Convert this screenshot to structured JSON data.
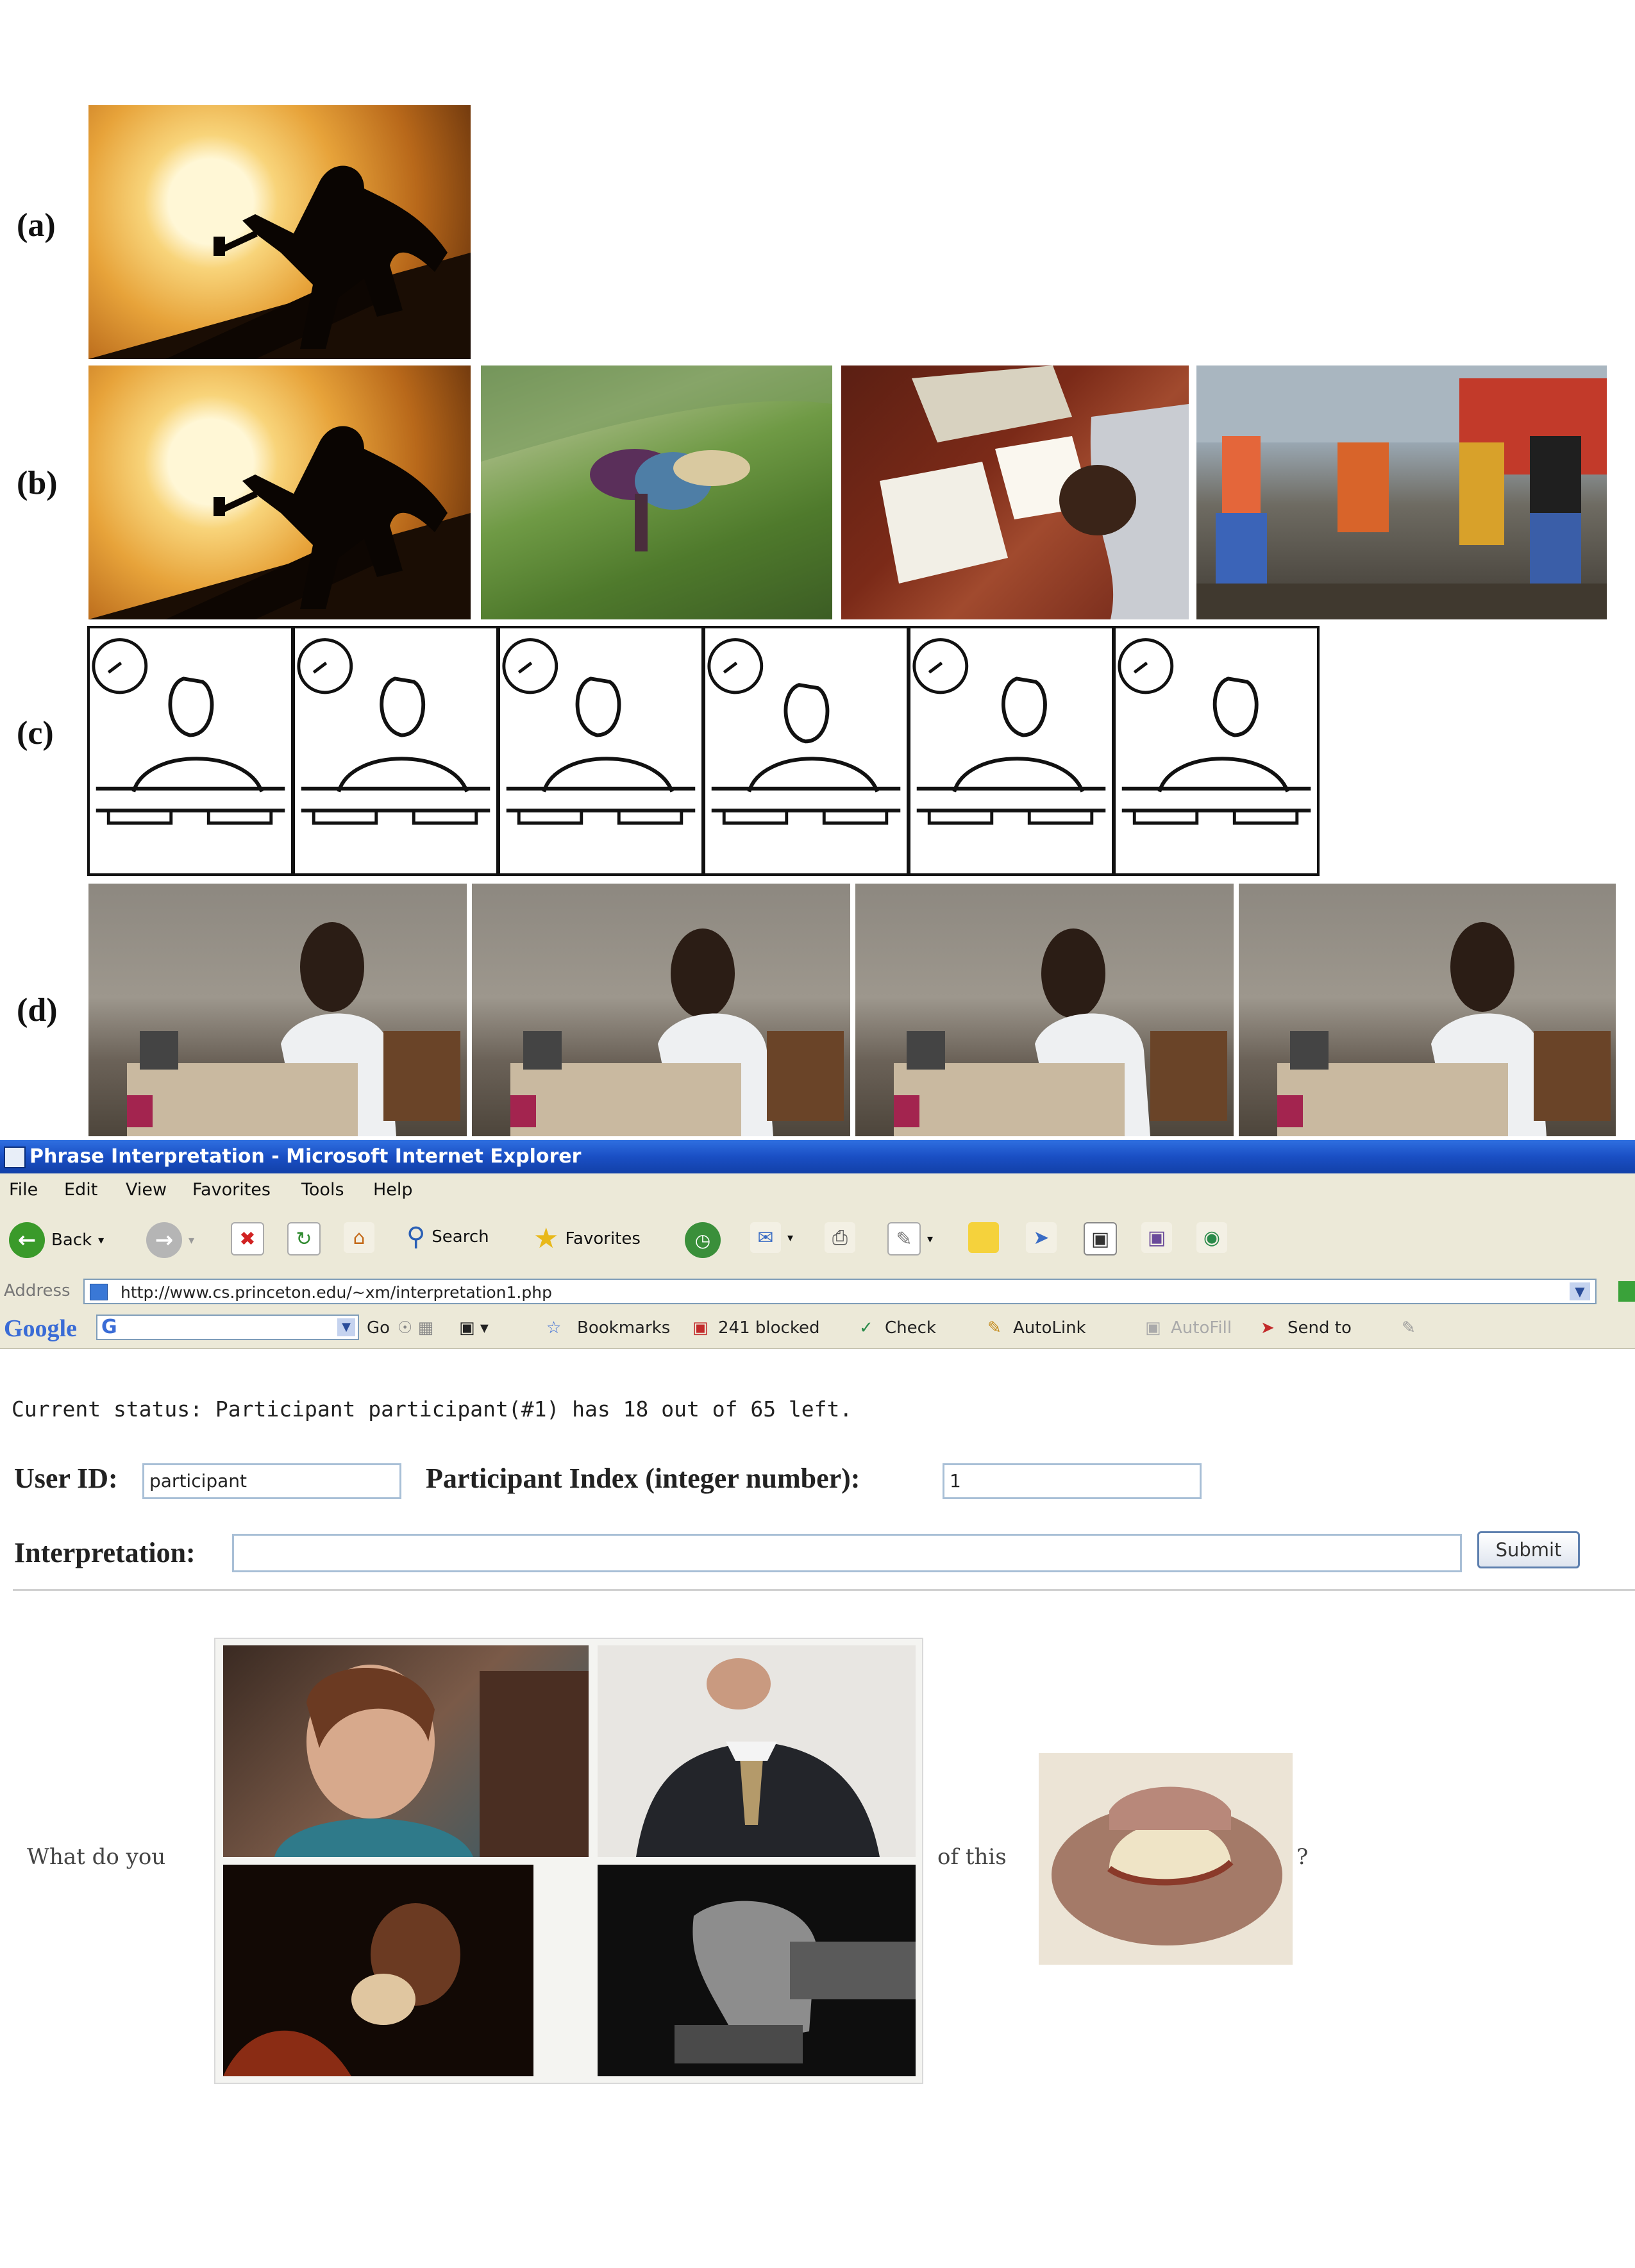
{
  "figure": {
    "row_labels": [
      "(a)",
      "(b)",
      "(c)",
      "(d)"
    ],
    "icons": {
      "sunset": "hammer-silhouette-image",
      "hillside": "farmer-field-image",
      "desk": "office-desk-image",
      "workers": "construction-workers-image",
      "sketch": "writing-sketch-image",
      "video": "woman-writing-frame-image"
    }
  },
  "browser": {
    "title": "Phrase Interpretation - Microsoft Internet Explorer",
    "menu": [
      "File",
      "Edit",
      "View",
      "Favorites",
      "Tools",
      "Help"
    ],
    "toolbar": {
      "back": "Back",
      "search": "Search",
      "favorites": "Favorites"
    },
    "address_label": "Address",
    "url": "http://www.cs.princeton.edu/~xm/interpretation1.php",
    "google": {
      "logo": "Google",
      "go": "Go",
      "bookmarks": "Bookmarks",
      "blocked": "241 blocked",
      "check": "Check",
      "autolink": "AutoLink",
      "autofill": "AutoFill",
      "sendto": "Send to"
    },
    "colors": {
      "titlebar": "#1a4fc4",
      "chrome": "#ece9d8"
    }
  },
  "page": {
    "status": "Current status: Participant participant(#1) has 18 out of 65 left.",
    "user_id_label": "User ID:",
    "user_id_value": "participant",
    "index_label": "Participant Index (integer number):",
    "index_value": "1",
    "interpretation_label": "Interpretation:",
    "interpretation_value": "",
    "submit_label": "Submit",
    "question_prefix": "What do you",
    "question_middle": "of this",
    "question_suffix": "?"
  }
}
